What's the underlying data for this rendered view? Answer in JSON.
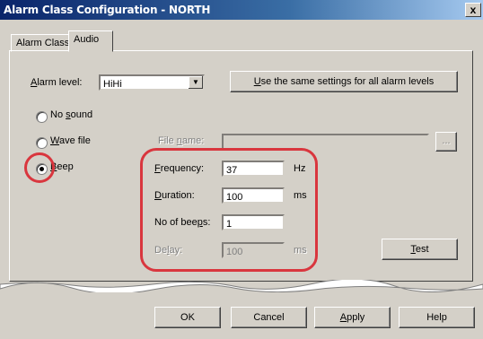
{
  "window": {
    "title": "Alarm Class Configuration - NORTH",
    "close_label": "x"
  },
  "tabs": [
    {
      "label": "Alarm Class"
    },
    {
      "label": "Audio"
    }
  ],
  "alarm_level": {
    "label_prefix": "A",
    "label_rest": "larm level:",
    "value": "HiHi"
  },
  "same_settings_button": {
    "u": "U",
    "rest": "se the same settings for all alarm levels"
  },
  "sound_options": {
    "no_sound": {
      "pre": "No ",
      "u": "s",
      "post": "ound"
    },
    "wave_file": {
      "u": "W",
      "post": "ave file"
    },
    "beep": {
      "u": "B",
      "post": "eep"
    },
    "selected": "beep"
  },
  "file_name": {
    "pre": "File ",
    "u": "n",
    "post": "ame:",
    "value": "",
    "browse_label": "..."
  },
  "beep_settings": {
    "frequency": {
      "u": "F",
      "post": "requency:",
      "value": "37",
      "unit": "Hz"
    },
    "duration": {
      "u": "D",
      "post": "uration:",
      "value": "100",
      "unit": "ms"
    },
    "no_of_beeps": {
      "pre": "No of bee",
      "u": "p",
      "post": "s:",
      "value": "1"
    },
    "delay": {
      "pre": "De",
      "u": "l",
      "post": "ay:",
      "value": "100",
      "unit": "ms"
    }
  },
  "test_button": {
    "u": "T",
    "rest": "est"
  },
  "footer_buttons": {
    "ok": "OK",
    "cancel": "Cancel",
    "apply": {
      "u": "A",
      "rest": "pply"
    },
    "help": "Help"
  },
  "colors": {
    "title_bar": "#0a246a",
    "highlight": "#d9363e",
    "face": "#d4d0c8"
  }
}
